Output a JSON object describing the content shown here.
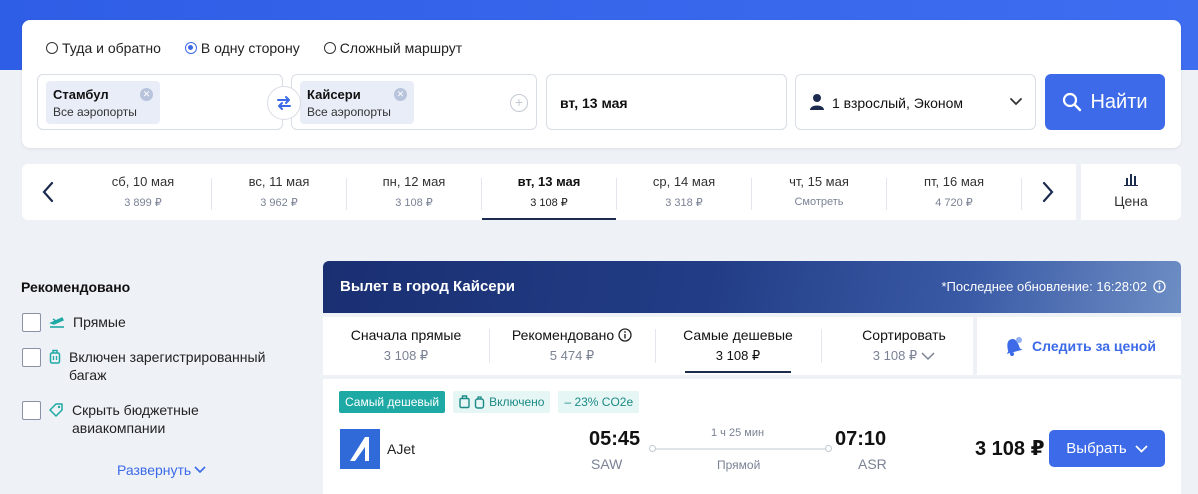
{
  "trip_types": [
    {
      "label": "Туда и обратно",
      "checked": false
    },
    {
      "label": "В одну сторону",
      "checked": true
    },
    {
      "label": "Сложный маршрут",
      "checked": false
    }
  ],
  "from": {
    "city": "Стамбул",
    "airports": "Все аэропорты"
  },
  "to": {
    "city": "Кайсери",
    "airports": "Все аэропорты"
  },
  "date": "вт, 13 мая",
  "passengers": "1 взрослый, Эконом",
  "search_label": "Найти",
  "days": [
    {
      "label": "сб, 10 мая",
      "price": "3 899 ₽",
      "selected": false
    },
    {
      "label": "вс, 11 мая",
      "price": "3 962 ₽",
      "selected": false
    },
    {
      "label": "пн, 12 мая",
      "price": "3 108 ₽",
      "selected": false
    },
    {
      "label": "вт, 13 мая",
      "price": "3 108 ₽",
      "selected": true
    },
    {
      "label": "ср, 14 мая",
      "price": "3 318 ₽",
      "selected": false
    },
    {
      "label": "чт, 15 мая",
      "price": "Смотреть",
      "selected": false
    },
    {
      "label": "пт, 16 мая",
      "price": "4 720 ₽",
      "selected": false
    }
  ],
  "price_chart_label": "Цена",
  "filters": {
    "title": "Рекомендовано",
    "items": [
      {
        "label": "Прямые",
        "icon": "plane-takeoff-icon"
      },
      {
        "label": "Включен зарегистрированный багаж",
        "icon": "luggage-icon"
      },
      {
        "label": "Скрыть бюджетные авиакомпании",
        "icon": "tag-icon"
      }
    ],
    "expand_label": "Развернуть"
  },
  "results": {
    "title": "Вылет в город Кайсери",
    "update": "*Последнее обновление: 16:28:02"
  },
  "sort_tabs": [
    {
      "title": "Сначала прямые",
      "sub": "3 108 ₽"
    },
    {
      "title": "Рекомендовано",
      "sub": "5 474 ₽"
    },
    {
      "title": "Самые дешевые",
      "sub": "3 108 ₽"
    },
    {
      "title": "Сортировать",
      "sub": "3 108 ₽"
    }
  ],
  "track_label": "Следить за ценой",
  "flight": {
    "badge_cheapest": "Самый дешевый",
    "badge_baggage": "Включено",
    "badge_co2": "– 23% CO2e",
    "airline": "AJet",
    "dep_time": "05:45",
    "dep_code": "SAW",
    "duration": "1 ч 25 мин",
    "stops": "Прямой",
    "arr_time": "07:10",
    "arr_code": "ASR",
    "price": "3 108 ₽",
    "select_label": "Выбрать"
  },
  "colors": {
    "accent": "#3c6ae8",
    "teal": "#1ea9a5",
    "navy": "#1d2b4f"
  }
}
